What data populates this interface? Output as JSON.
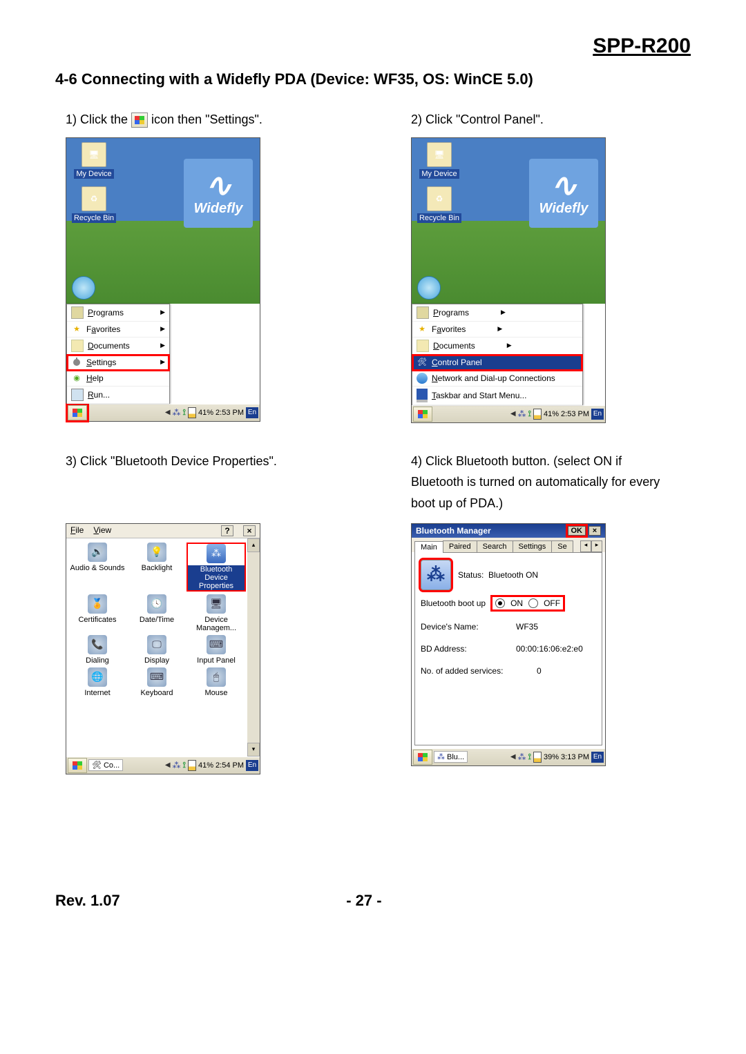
{
  "header": "SPP-R200",
  "section": "4-6 Connecting with a Widefly PDA (Device: WF35, OS: WinCE 5.0)",
  "step1_a": "1) Click the ",
  "step1_b": " icon then \"Settings\".",
  "step2": "2) Click \"Control Panel\".",
  "step3": "3) Click \"Bluetooth Device Properties\".",
  "step4": "4) Click Bluetooth button. (select ON if Bluetooth is turned on automatically for every boot up of PDA.)",
  "desk": {
    "myDevice": "My Device",
    "recycle": "Recycle Bin",
    "brand": "Widefly"
  },
  "startMenu": {
    "programs": "Programs",
    "favorites": "Favorites",
    "documents": "Documents",
    "settings": "Settings",
    "help": "Help",
    "run": "Run...",
    "controlPanel": "Control Panel",
    "network": "Network and Dial-up Connections",
    "taskbar": "Taskbar and Start Menu..."
  },
  "tray": {
    "batt1": "41%",
    "time1": "2:53 PM",
    "batt3": "41%",
    "time3": "2:54 PM",
    "batt4": "39%",
    "time4": "3:13 PM",
    "lang": "En"
  },
  "cp": {
    "file": "File",
    "view": "View",
    "items": [
      "Audio & Sounds",
      "Backlight",
      "Bluetooth Device Properties",
      "Certificates",
      "Date/Time",
      "Device Managem...",
      "Dialing",
      "Display",
      "Input Panel",
      "Internet",
      "Keyboard",
      "Mouse"
    ],
    "task": "Co..."
  },
  "bt": {
    "title": "Bluetooth Manager",
    "ok": "OK",
    "tabs": [
      "Main",
      "Paired",
      "Search",
      "Settings",
      "Se"
    ],
    "statusLbl": "Status:",
    "statusVal": "Bluetooth ON",
    "bootup": "Bluetooth boot up",
    "on": "ON",
    "off": "OFF",
    "devNameLbl": "Device's Name:",
    "devName": "WF35",
    "bdLbl": "BD Address:",
    "bd": "00:00:16:06:e2:e0",
    "svcLbl": "No. of added services:",
    "svc": "0",
    "task": "Blu..."
  },
  "footer": {
    "rev": "Rev. 1.07",
    "page": "- 27 -"
  }
}
